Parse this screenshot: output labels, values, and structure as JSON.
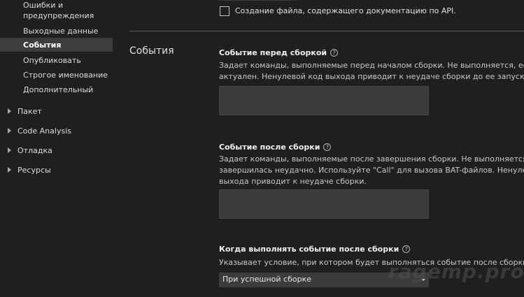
{
  "sidebar": {
    "sub_items": [
      {
        "label": "Ошибки и",
        "label2": "предупреждения"
      },
      {
        "label": "Выходные данные"
      },
      {
        "label": "События"
      },
      {
        "label": "Опубликовать"
      },
      {
        "label": "Строгое именование"
      },
      {
        "label": "Дополнительный"
      }
    ],
    "groups": [
      {
        "label": "Пакет"
      },
      {
        "label": "Code Analysis"
      },
      {
        "label": "Отладка"
      },
      {
        "label": "Ресурсы"
      }
    ]
  },
  "main": {
    "top_checkbox_label": "Создание файла, содержащего документацию по API.",
    "section_title": "События",
    "pre_build": {
      "title": "Событие перед сборкой",
      "desc": [
        "Задает команды, выполняемые перед началом сборки. Не выполняется, если",
        "актуален. Ненулевой код выхода приводит к неудаче сборки до ее запуска."
      ],
      "value": ""
    },
    "post_build": {
      "title": "Событие после сборки",
      "desc": [
        "Задает команды, выполняемые после завершения сборки. Не выполняется, ес",
        "завершилась неудачно. Используйте \"Call\" для вызова BAT-файлов. Ненулевой",
        "выхода приводит к неудаче сборки."
      ],
      "value": ""
    },
    "run_when": {
      "title": "Когда выполнять событие после сборки",
      "desc": "Указывает условие, при котором будет выполняться событие после сборки.",
      "selected": "При успешной сборке"
    },
    "help_glyph": "?"
  },
  "watermark": "ragemp.pro",
  "colors": {
    "background": "#1f1f1f",
    "selected_item": "#3d3d3d",
    "textbox": "#3c3c3c"
  }
}
